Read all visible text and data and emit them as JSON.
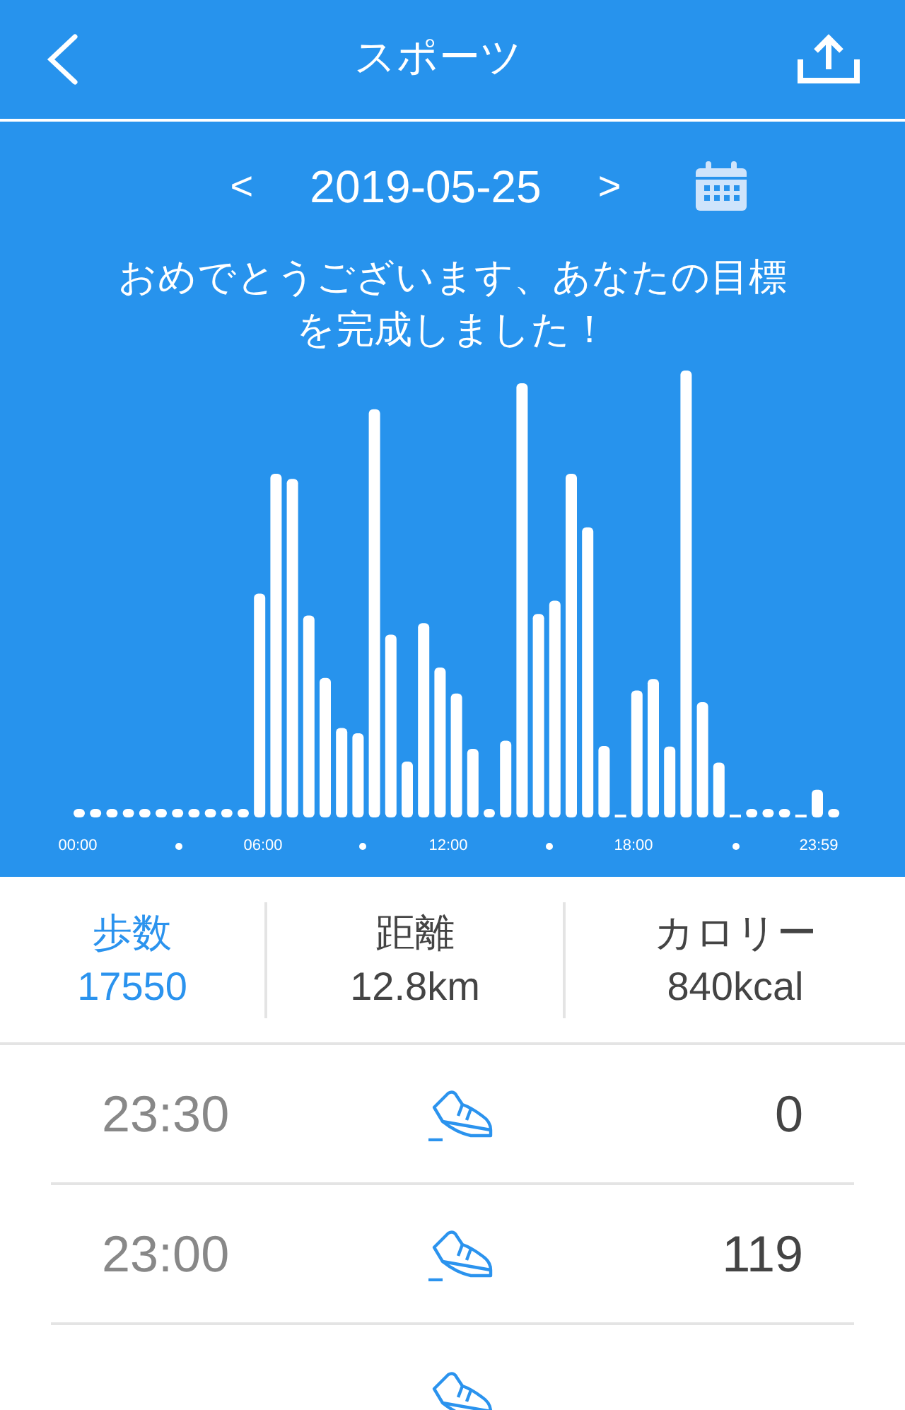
{
  "header": {
    "title": "スポーツ"
  },
  "date_nav": {
    "prev": "<",
    "date": "2019-05-25",
    "next": ">"
  },
  "message": "おめでとうございます、あなたの目標を完成しました！",
  "chart": {
    "axis_labels": [
      "00:00",
      "06:00",
      "12:00",
      "18:00",
      "23:59"
    ]
  },
  "stats": [
    {
      "label": "歩数",
      "value": "17550",
      "selected": true
    },
    {
      "label": "距離",
      "value": "12.8km",
      "selected": false
    },
    {
      "label": "カロリー",
      "value": "840kcal",
      "selected": false
    }
  ],
  "records": [
    {
      "time": "23:30",
      "steps": "0"
    },
    {
      "time": "23:00",
      "steps": "119"
    }
  ],
  "more_rows_below": true
}
